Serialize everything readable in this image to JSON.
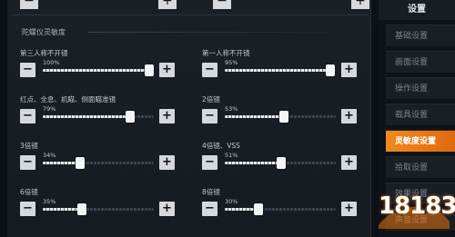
{
  "section": {
    "title": "陀螺仪灵敏度"
  },
  "sliders": [
    {
      "label": "第三人称不开镜",
      "percent_text": "100%",
      "value": 100
    },
    {
      "label": "第一人称不开镜",
      "percent_text": "95%",
      "value": 95
    },
    {
      "label": "红点、全息、机瞄、侧面瞄准镜",
      "percent_text": "79%",
      "value": 79
    },
    {
      "label": "2倍镜",
      "percent_text": "53%",
      "value": 53
    },
    {
      "label": "3倍镜",
      "percent_text": "34%",
      "value": 34
    },
    {
      "label": "4倍镜、VSS",
      "percent_text": "51%",
      "value": 51
    },
    {
      "label": "6倍镜",
      "percent_text": "35%",
      "value": 35
    },
    {
      "label": "8倍镜",
      "percent_text": "30%",
      "value": 30
    }
  ],
  "buttons": {
    "minus": "−",
    "plus": "+"
  },
  "sidebar": {
    "header": "设置",
    "items": [
      {
        "label": "基础设置",
        "active": false
      },
      {
        "label": "画面设置",
        "active": false
      },
      {
        "label": "操作设置",
        "active": false
      },
      {
        "label": "载具设置",
        "active": false
      },
      {
        "label": "灵敏度设置",
        "active": true
      },
      {
        "label": "拾取设置",
        "active": false
      },
      {
        "label": "效果设置",
        "active": false
      },
      {
        "label": "声音设置",
        "active": false
      }
    ]
  },
  "watermark": {
    "brand": "18183",
    "sub": ""
  },
  "colors": {
    "accent": "#e8730d",
    "panel": "#1b2027",
    "button": "#d6d8db"
  }
}
